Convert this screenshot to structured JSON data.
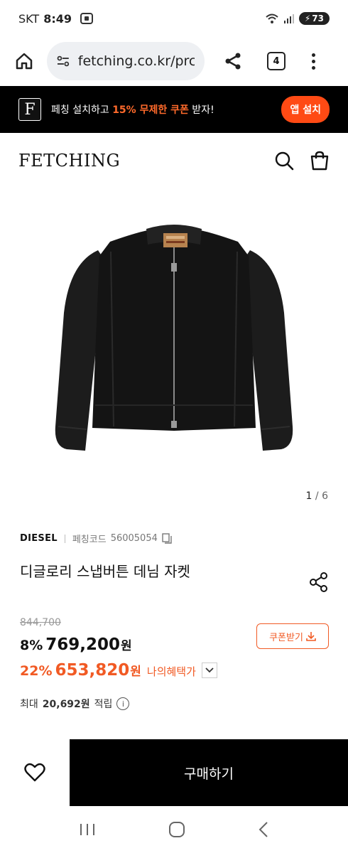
{
  "status_bar": {
    "carrier": "SKT",
    "time": "8:49",
    "battery": "73"
  },
  "browser": {
    "url": "fetching.co.kr/prc",
    "tab_count": "4"
  },
  "promo": {
    "logo_letter": "F",
    "text_before": "페칭 설치하고 ",
    "text_highlight": "15% 무제한 쿠폰",
    "text_after": " 받자!",
    "button_label": "앱 설치",
    "accent_color": "#ff4a14"
  },
  "header": {
    "logo": "FETCHING"
  },
  "gallery": {
    "current": "1",
    "separator": "/",
    "total": "6"
  },
  "product": {
    "brand": "DIESEL",
    "code_label": "페칭코드",
    "code": "56005054",
    "title": "디글로리 스냅버튼 데님 자켓",
    "original_price": "844,700",
    "discount_pct": "8%",
    "price": "769,200",
    "won": "원",
    "benefit_pct": "22%",
    "benefit_price": "653,820",
    "benefit_label": "나의혜택가",
    "coupon_label": "쿠폰받기",
    "points_prefix": "최대",
    "points": "20,692원",
    "points_suffix": "적립",
    "info_symbol": "i"
  },
  "actions": {
    "buy_label": "구매하기"
  },
  "icons": {
    "home": "home-icon",
    "share": "share-icon",
    "search": "search-icon",
    "bag": "shopping-bag-icon",
    "heart": "heart-icon",
    "download": "download-icon"
  }
}
